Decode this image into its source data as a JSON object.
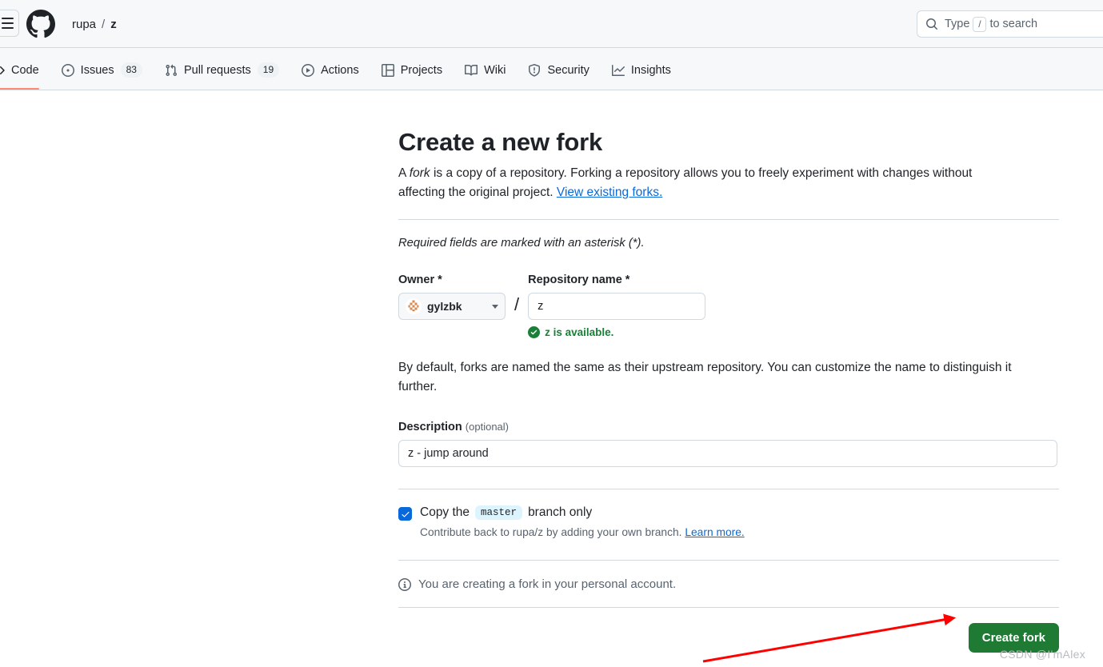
{
  "header": {
    "menu_icon": "hamburger-menu-icon",
    "logo_icon": "github-logo-icon",
    "breadcrumb": {
      "owner": "rupa",
      "separator": "/",
      "repo": "z"
    },
    "search": {
      "icon": "search-icon",
      "prefix": "Type",
      "key": "/",
      "suffix": "to search"
    }
  },
  "repo_nav": {
    "items": [
      {
        "label": "Code",
        "icon": "code-icon",
        "count": null,
        "active": true
      },
      {
        "label": "Issues",
        "icon": "issue-opened-icon",
        "count": "83",
        "active": false
      },
      {
        "label": "Pull requests",
        "icon": "git-pull-request-icon",
        "count": "19",
        "active": false
      },
      {
        "label": "Actions",
        "icon": "play-circle-icon",
        "count": null,
        "active": false
      },
      {
        "label": "Projects",
        "icon": "project-table-icon",
        "count": null,
        "active": false
      },
      {
        "label": "Wiki",
        "icon": "book-icon",
        "count": null,
        "active": false
      },
      {
        "label": "Security",
        "icon": "shield-icon",
        "count": null,
        "active": false
      },
      {
        "label": "Insights",
        "icon": "graph-icon",
        "count": null,
        "active": false
      }
    ]
  },
  "fork_form": {
    "title": "Create a new fork",
    "intro_part1": "A ",
    "intro_italic": "fork",
    "intro_part2": " is a copy of a repository. Forking a repository allows you to freely experiment with changes without affecting the original project. ",
    "intro_link": "View existing forks.",
    "required_note": "Required fields are marked with an asterisk (*).",
    "owner": {
      "label": "Owner *",
      "value": "gylzbk",
      "avatar_icon": "user-avatar-identicon",
      "caret_icon": "chevron-down-icon"
    },
    "slash": "/",
    "repository": {
      "label": "Repository name *",
      "value": "z",
      "availability_icon": "check-circle-fill-icon",
      "availability_text": "z is available."
    },
    "by_default_note": "By default, forks are named the same as their upstream repository. You can customize the name to distinguish it further.",
    "description": {
      "label": "Description",
      "optional": "(optional)",
      "value": "z - jump around"
    },
    "copy_branch": {
      "checked": true,
      "text_before": "Copy the",
      "branch": "master",
      "text_after": "branch only",
      "help_text": "Contribute back to rupa/z by adding your own branch. ",
      "help_link": "Learn more."
    },
    "personal_note": {
      "icon": "info-icon",
      "text": "You are creating a fork in your personal account."
    },
    "submit_label": "Create fork"
  },
  "annotation": {
    "arrow_color": "#ff0000",
    "watermark": "CSDN @I'mAlex"
  },
  "colors": {
    "accent": "#0969da",
    "success": "#1a7f37",
    "button_green": "#1f7a34",
    "active_tab_underline": "#fd8c73",
    "header_bg": "#f6f8fa",
    "border": "#d1d9e0"
  }
}
